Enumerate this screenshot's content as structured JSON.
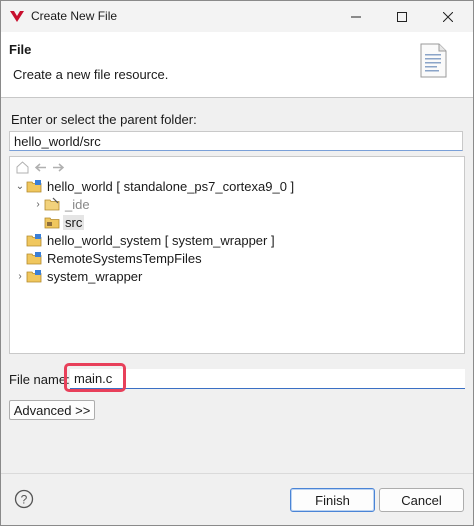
{
  "window": {
    "title": "Create New File"
  },
  "banner": {
    "title": "File",
    "description": "Create a new file resource."
  },
  "parent_folder": {
    "label": "Enter or select the parent folder:",
    "value": "hello_world/src"
  },
  "tree": {
    "items": [
      {
        "label": "hello_world [ standalone_ps7_cortexa9_0 ]",
        "expanded": true
      },
      {
        "label": "_ide",
        "expanded": false
      },
      {
        "label": "src",
        "selected": true
      },
      {
        "label": "hello_world_system [ system_wrapper ]"
      },
      {
        "label": "RemoteSystemsTempFiles"
      },
      {
        "label": "system_wrapper",
        "expanded": false
      }
    ]
  },
  "file_name": {
    "label": "File name:",
    "value": "main.c"
  },
  "advanced_label": "Advanced >>",
  "buttons": {
    "finish": "Finish",
    "cancel": "Cancel"
  },
  "colors": {
    "highlight": "#e8405a",
    "focus_border": "#3a6fc4",
    "accent": "#4a84d6"
  }
}
